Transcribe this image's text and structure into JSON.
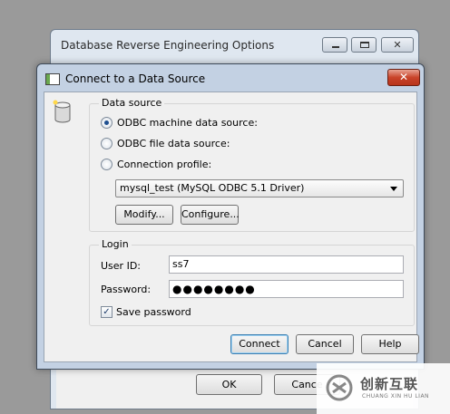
{
  "background_window": {
    "title": "Database Reverse Engineering Options",
    "close_glyph": "✕",
    "ok_label": "OK",
    "cancel_label": "Cance"
  },
  "dialog": {
    "title": "Connect to a Data Source",
    "close_glyph": "✕",
    "data_source": {
      "group_label": "Data source",
      "options": [
        {
          "label": "ODBC machine data source:",
          "checked": true
        },
        {
          "label": "ODBC file data source:",
          "checked": false
        },
        {
          "label": "Connection profile:",
          "checked": false
        }
      ],
      "selected_source": "mysql_test (MySQL ODBC 5.1 Driver)",
      "modify_label": "Modify...",
      "configure_label": "Configure..."
    },
    "login": {
      "group_label": "Login",
      "user_id_label": "User ID:",
      "user_id_value": "ss7",
      "password_label": "Password:",
      "password_value": "●●●●●●●●",
      "save_password_label": "Save password",
      "save_password_checked": true,
      "checkmark": "✓"
    },
    "buttons": {
      "connect": "Connect",
      "cancel": "Cancel",
      "help": "Help"
    }
  },
  "watermark": {
    "brand": "创新互联",
    "sub": "CHUANG XIN HU LIAN"
  },
  "icons": {
    "database": "database-icon",
    "window": "window-icon"
  }
}
